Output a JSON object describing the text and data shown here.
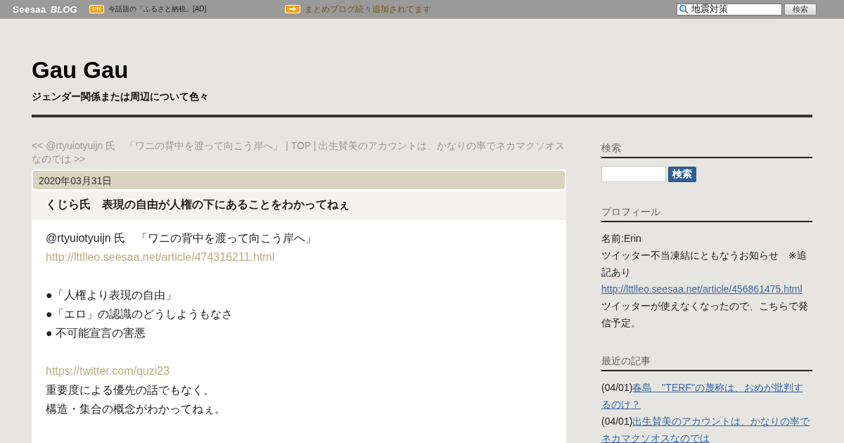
{
  "topbar": {
    "logo": "Seesaa",
    "logo_sub": "BLOG",
    "pr_badge": "PR",
    "pr_text": "今話題の「ふるさと納税」[AD]",
    "notice": "まとめブログ続々追加されてます",
    "search_value": "地震対策",
    "search_button": "検索"
  },
  "blog": {
    "title": "Gau Gau",
    "subtitle": "ジェンダー関係または周辺について色々"
  },
  "nav": {
    "separator": "|",
    "links": [
      "<< @rtyuiotyuijn 氏　「ワニの背中を渡って向こう岸へ」",
      "TOP",
      "出生賛美のアカウントは、かなりの率でネカマクソオスなのでは >>"
    ]
  },
  "article": {
    "date": "2020年03月31日",
    "title": "くじら氏　表現の自由が人権の下にあることをわかってねぇ",
    "lines": [
      {
        "kind": "text",
        "text": "@rtyuiotyuijn 氏　「ワニの背中を渡って向こう岸へ」"
      },
      {
        "kind": "link",
        "text": "http://lttlleo.seesaa.net/article/474316211.html"
      },
      {
        "kind": "blank"
      },
      {
        "kind": "text",
        "text": "●「人権より表現の自由」"
      },
      {
        "kind": "text",
        "text": "●「エロ」の認識のどうしようもなさ"
      },
      {
        "kind": "text",
        "text": "● 不可能宣言の害悪"
      },
      {
        "kind": "blank"
      },
      {
        "kind": "link",
        "text": "https://twitter.com/quzi23"
      },
      {
        "kind": "text",
        "text": "重要度による優先の話でもなく、"
      },
      {
        "kind": "text",
        "text": "構造・集合の概念がわかってねぇ。"
      }
    ]
  },
  "sidebar": {
    "search": {
      "heading": "検索",
      "button": "検索"
    },
    "profile": {
      "heading": "プロフィール",
      "items": [
        {
          "kind": "text",
          "text": "名前:Erin"
        },
        {
          "kind": "text",
          "text": "ツイッター不当凍結にともなうお知らせ　※追記あり"
        },
        {
          "kind": "link",
          "text": "http://lttlleo.seesaa.net/article/456861475.html"
        },
        {
          "kind": "text",
          "text": "ツイッターが使えなくなったので、こちらで発信予定。"
        }
      ]
    },
    "recent": {
      "heading": "最近の記事",
      "items": [
        {
          "date": "(04/01)",
          "title": "春島　\"TERF\"の蔑称は、おめが批判するのけ？"
        },
        {
          "date": "(04/01)",
          "title": "出生賛美のアカウントは、かなりの率でネカマクソオスなのでは"
        }
      ]
    }
  }
}
